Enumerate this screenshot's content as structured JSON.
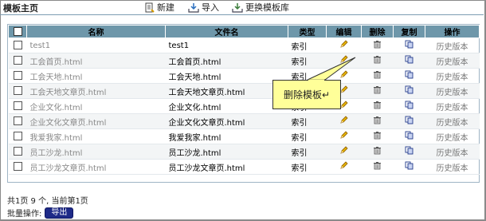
{
  "header": {
    "title": "模板主页",
    "new_label": "新建",
    "import_label": "导入",
    "change_label": "更换模板库"
  },
  "columns": [
    "名称",
    "文件名",
    "类型",
    "编辑",
    "删除",
    "复制",
    "操作"
  ],
  "rows": [
    {
      "name": "test1",
      "file": "test1",
      "type": "索引",
      "action": "历史版本"
    },
    {
      "name": "工会首页.html",
      "file": "工会首页.html",
      "type": "索引",
      "action": "历史版本"
    },
    {
      "name": "工会天地.html",
      "file": "工会天地.html",
      "type": "索引",
      "action": "历史版本"
    },
    {
      "name": "工会天地文章页.html",
      "file": "工会天地文章页.html",
      "type": "索引",
      "action": "历史版本"
    },
    {
      "name": "企业文化.html",
      "file": "企业文化.html",
      "type": "索引",
      "action": "历史版本"
    },
    {
      "name": "企业文化文章页.html",
      "file": "企业文化文章页.html",
      "type": "索引",
      "action": "历史版本"
    },
    {
      "name": "我爱我家.html",
      "file": "我爱我家.html",
      "type": "索引",
      "action": "历史版本"
    },
    {
      "name": "员工沙龙.html",
      "file": "员工沙龙.html",
      "type": "索引",
      "action": "历史版本"
    },
    {
      "name": "员工沙龙文章页.html",
      "file": "员工沙龙文章页.html",
      "type": "索引",
      "action": "历史版本"
    }
  ],
  "callout": "删除模板↵",
  "pager": "共1页  9 个, 当前第1页",
  "batch": {
    "label": "批量操作:",
    "export_label": "导出"
  },
  "colors": {
    "header_bg": "#6e97aa",
    "callout_bg": "#ffff99",
    "export_bg": "#1e2a88"
  },
  "icons": {
    "edit": "pencil-icon",
    "delete": "trash-icon",
    "copy": "copy-icon"
  }
}
